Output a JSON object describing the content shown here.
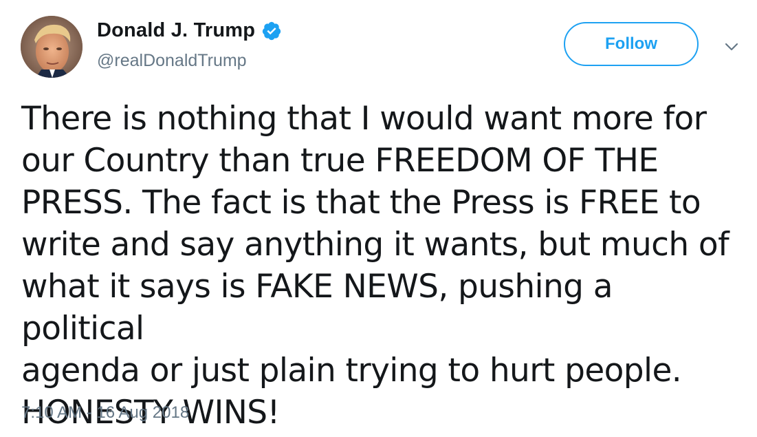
{
  "author": {
    "display_name": "Donald J. Trump",
    "handle": "@realDonaldTrump",
    "verified": true,
    "avatar_icon": "profile-photo"
  },
  "actions": {
    "follow_label": "Follow",
    "more_icon": "chevron-down-icon"
  },
  "tweet": {
    "text": "There is nothing that I would want more for\nour Country than true FREEDOM OF THE\nPRESS. The fact is that the Press is FREE to\nwrite and say anything it wants, but much of\nwhat it says is FAKE NEWS, pushing a political\nagenda or just plain trying to hurt people.\nHONESTY WINS!",
    "timestamp": "7:10 AM - 16 Aug 2018"
  },
  "colors": {
    "accent": "#1da1f2",
    "text_primary": "#14171a",
    "text_secondary": "#657786",
    "background": "#ffffff"
  }
}
